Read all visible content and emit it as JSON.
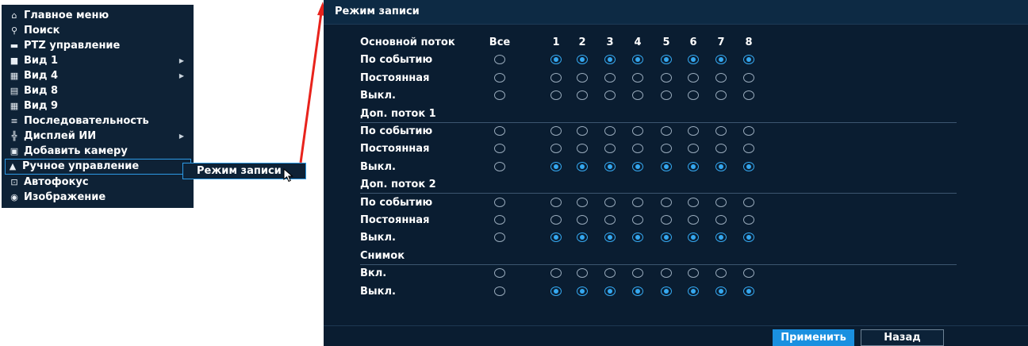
{
  "menu": {
    "items": [
      {
        "label": "Главное меню",
        "icon": "home-icon",
        "glyph": "⌂",
        "arrow": ""
      },
      {
        "label": "Поиск",
        "icon": "search-icon",
        "glyph": "⚲",
        "arrow": ""
      },
      {
        "label": "PTZ управление",
        "icon": "ptz-camera-icon",
        "glyph": "▬",
        "arrow": ""
      },
      {
        "label": "Вид 1",
        "icon": "view-1-icon",
        "glyph": "■",
        "arrow": "▶"
      },
      {
        "label": "Вид 4",
        "icon": "view-4-icon",
        "glyph": "▦",
        "arrow": "▶"
      },
      {
        "label": "Вид 8",
        "icon": "view-8-icon",
        "glyph": "▤",
        "arrow": ""
      },
      {
        "label": "Вид 9",
        "icon": "view-9-icon",
        "glyph": "▦",
        "arrow": ""
      },
      {
        "label": "Последовательность",
        "icon": "sequence-icon",
        "glyph": "≡",
        "arrow": ""
      },
      {
        "label": "Дисплей ИИ",
        "icon": "ai-display-icon",
        "glyph": "╬",
        "arrow": "▶"
      },
      {
        "label": "Добавить камеру",
        "icon": "add-camera-icon",
        "glyph": "▣",
        "arrow": ""
      },
      {
        "label": "Ручное управление",
        "icon": "manual-control-icon",
        "glyph": "▲",
        "arrow": "",
        "active": true
      },
      {
        "label": "Автофокус",
        "icon": "autofocus-icon",
        "glyph": "⊡",
        "arrow": ""
      },
      {
        "label": "Изображение",
        "icon": "image-settings-icon",
        "glyph": "◉",
        "arrow": ""
      }
    ],
    "submenu_label": "Режим записи"
  },
  "dialog": {
    "title": "Режим записи",
    "columns": {
      "all": "Все",
      "channels": [
        "1",
        "2",
        "3",
        "4",
        "5",
        "6",
        "7",
        "8"
      ]
    },
    "rows": [
      {
        "type": "header",
        "label": "Основной поток"
      },
      {
        "type": "radio",
        "label": "По событию",
        "all": false,
        "channels": [
          true,
          true,
          true,
          true,
          true,
          true,
          true,
          true
        ]
      },
      {
        "type": "radio",
        "label": "Постоянная",
        "all": false,
        "channels": [
          false,
          false,
          false,
          false,
          false,
          false,
          false,
          false
        ]
      },
      {
        "type": "radio",
        "label": "Выкл.",
        "all": false,
        "channels": [
          false,
          false,
          false,
          false,
          false,
          false,
          false,
          false
        ]
      },
      {
        "type": "section",
        "label": "Доп. поток 1"
      },
      {
        "type": "radio",
        "label": "По событию",
        "all": false,
        "channels": [
          false,
          false,
          false,
          false,
          false,
          false,
          false,
          false
        ]
      },
      {
        "type": "radio",
        "label": "Постоянная",
        "all": false,
        "channels": [
          false,
          false,
          false,
          false,
          false,
          false,
          false,
          false
        ]
      },
      {
        "type": "radio",
        "label": "Выкл.",
        "all": false,
        "channels": [
          true,
          true,
          true,
          true,
          true,
          true,
          true,
          true
        ]
      },
      {
        "type": "section",
        "label": "Доп. поток 2"
      },
      {
        "type": "radio",
        "label": "По событию",
        "all": false,
        "channels": [
          false,
          false,
          false,
          false,
          false,
          false,
          false,
          false
        ]
      },
      {
        "type": "radio",
        "label": "Постоянная",
        "all": false,
        "channels": [
          false,
          false,
          false,
          false,
          false,
          false,
          false,
          false
        ]
      },
      {
        "type": "radio",
        "label": "Выкл.",
        "all": false,
        "channels": [
          true,
          true,
          true,
          true,
          true,
          true,
          true,
          true
        ]
      },
      {
        "type": "section",
        "label": "Снимок"
      },
      {
        "type": "radio",
        "label": "Вкл.",
        "all": false,
        "channels": [
          false,
          false,
          false,
          false,
          false,
          false,
          false,
          false
        ]
      },
      {
        "type": "radio",
        "label": "Выкл.",
        "all": false,
        "channels": [
          true,
          true,
          true,
          true,
          true,
          true,
          true,
          true
        ]
      }
    ],
    "buttons": {
      "apply": "Применить",
      "back": "Назад"
    }
  },
  "colors": {
    "accent": "#35a8f0",
    "panel": "#0a1d31",
    "menu": "#0e2236",
    "pointer_arrow": "#e8231c"
  }
}
